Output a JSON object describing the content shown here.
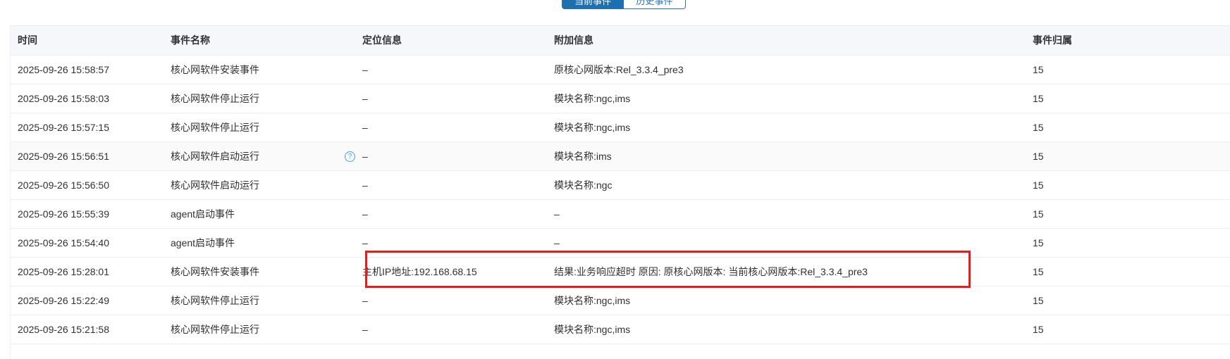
{
  "tabs": [
    {
      "label": "当前事件"
    },
    {
      "label": "历史事件"
    }
  ],
  "table": {
    "columns": [
      "时间",
      "事件名称",
      "定位信息",
      "附加信息",
      "事件归属"
    ],
    "rows": [
      {
        "time": "2025-09-26 15:58:57",
        "name": "核心网软件安装事件",
        "location": "–",
        "extra": "原核心网版本:Rel_3.3.4_pre3",
        "owner": "15"
      },
      {
        "time": "2025-09-26 15:58:03",
        "name": "核心网软件停止运行",
        "location": "–",
        "extra": "模块名称:ngc,ims",
        "owner": "15"
      },
      {
        "time": "2025-09-26 15:57:15",
        "name": "核心网软件停止运行",
        "location": "–",
        "extra": "模块名称:ngc,ims",
        "owner": "15"
      },
      {
        "time": "2025-09-26 15:56:51",
        "name": "核心网软件启动运行",
        "location": "–",
        "extra": "模块名称:ims",
        "owner": "15"
      },
      {
        "time": "2025-09-26 15:56:50",
        "name": "核心网软件启动运行",
        "location": "–",
        "extra": "模块名称:ngc",
        "owner": "15"
      },
      {
        "time": "2025-09-26 15:55:39",
        "name": "agent启动事件",
        "location": "–",
        "extra": "–",
        "owner": "15"
      },
      {
        "time": "2025-09-26 15:54:40",
        "name": "agent启动事件",
        "location": "–",
        "extra": "–",
        "owner": "15"
      },
      {
        "time": "2025-09-26 15:28:01",
        "name": "核心网软件安装事件",
        "location": "主机IP地址:192.168.68.15",
        "extra": "结果:业务响应超时 原因: 原核心网版本: 当前核心网版本:Rel_3.3.4_pre3",
        "owner": "15"
      },
      {
        "time": "2025-09-26 15:22:49",
        "name": "核心网软件停止运行",
        "location": "–",
        "extra": "模块名称:ngc,ims",
        "owner": "15"
      },
      {
        "time": "2025-09-26 15:21:58",
        "name": "核心网软件停止运行",
        "location": "–",
        "extra": "模块名称:ngc,ims",
        "owner": "15"
      }
    ]
  },
  "help_icon_glyph": "?",
  "colors": {
    "accent": "#1d6fb0",
    "highlight": "#e02020",
    "header_bg": "#f5f7fa"
  }
}
